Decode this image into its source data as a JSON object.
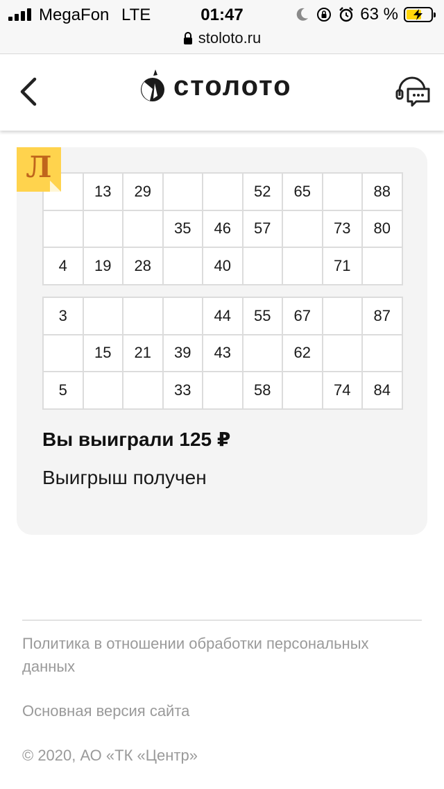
{
  "status_bar": {
    "carrier": "MegaFon",
    "network": "LTE",
    "time": "01:47",
    "battery_percent": "63 %",
    "battery_level": 0.63,
    "icons": [
      "signal-icon",
      "moon-icon",
      "rotation-lock-icon",
      "alarm-icon",
      "battery-charging-icon"
    ]
  },
  "browser": {
    "url": "stoloto.ru",
    "lock_icon": "lock-icon"
  },
  "header": {
    "back_icon": "chevron-left-icon",
    "logo_text": "столото",
    "support_icon": "support-chat-icon"
  },
  "ticket": {
    "badge_letter": "Л",
    "badge_color": "#ffd34d",
    "badge_letter_color": "#c0651c",
    "field1": [
      [
        "",
        "13",
        "29",
        "",
        "",
        "52",
        "65",
        "",
        "88"
      ],
      [
        "",
        "",
        "",
        "35",
        "46",
        "57",
        "",
        "73",
        "80"
      ],
      [
        "4",
        "19",
        "28",
        "",
        "40",
        "",
        "",
        "71",
        ""
      ]
    ],
    "field2": [
      [
        "3",
        "",
        "",
        "",
        "44",
        "55",
        "67",
        "",
        "87"
      ],
      [
        "",
        "15",
        "21",
        "39",
        "43",
        "",
        "62",
        "",
        ""
      ],
      [
        "5",
        "",
        "",
        "33",
        "",
        "58",
        "",
        "74",
        "84"
      ]
    ],
    "win_title": "Вы выиграли 125 ₽",
    "win_status": "Выигрыш получен"
  },
  "footer": {
    "policy_link": "Политика в отношении обработки персональных данных",
    "main_version_link": "Основная версия сайта",
    "copyright": "© 2020, АО «ТК «Центр»"
  }
}
